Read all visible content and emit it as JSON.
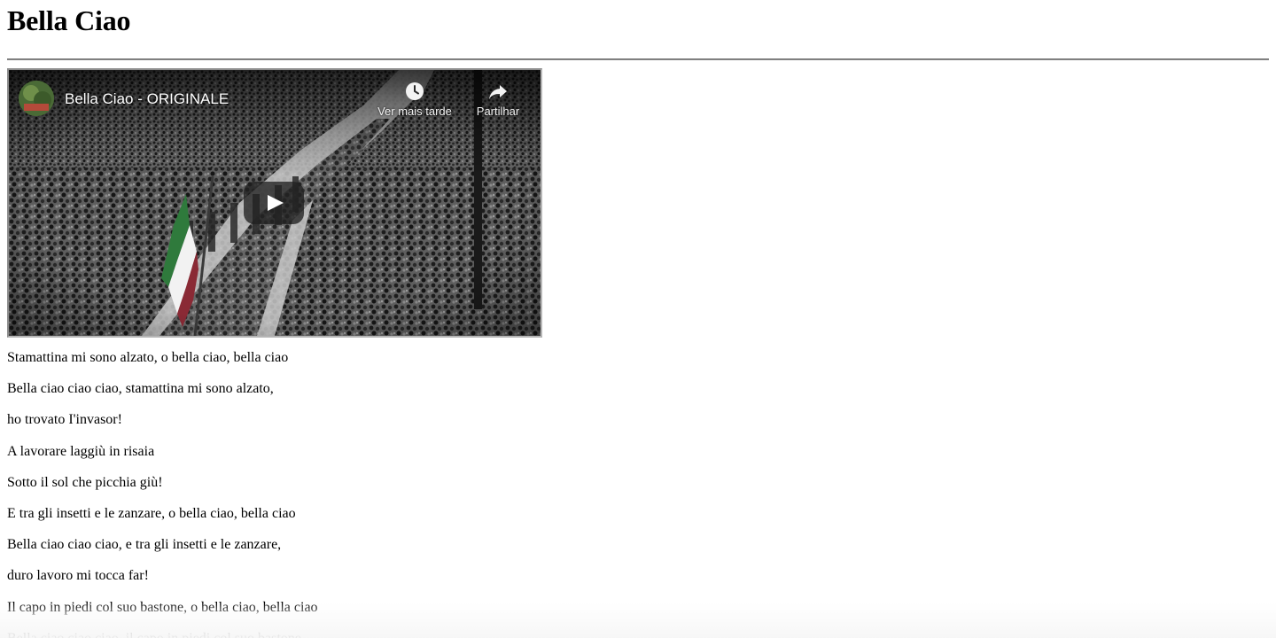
{
  "page": {
    "title": "Bella Ciao"
  },
  "video": {
    "title": "Bella Ciao - ORIGINALE",
    "watch_later_label": "Ver mais tarde",
    "share_label": "Partilhar",
    "icons": {
      "watch_later": "clock-icon",
      "share": "share-arrow-icon",
      "play": "play-icon",
      "avatar": "channel-avatar"
    },
    "colors": {
      "flag_green": "#2f7a3c",
      "flag_white": "#f2f2f2",
      "flag_red": "#8a2a35"
    }
  },
  "lyrics": [
    "Stamattina mi sono alzato, o bella ciao, bella ciao",
    "Bella ciao ciao ciao, stamattina mi sono alzato,",
    "ho trovato I'invasor!",
    "A lavorare laggiù in risaia",
    "Sotto il sol che picchia giù!",
    "E tra gli insetti e le zanzare, o bella ciao, bella ciao",
    "Bella ciao ciao ciao, e tra gli insetti e le zanzare,",
    "duro lavoro mi tocca far!",
    "Il capo in piedi col suo bastone, o bella ciao, bella ciao",
    "Bella ciao ciao ciao, il capo in piedi col suo bastone,"
  ]
}
